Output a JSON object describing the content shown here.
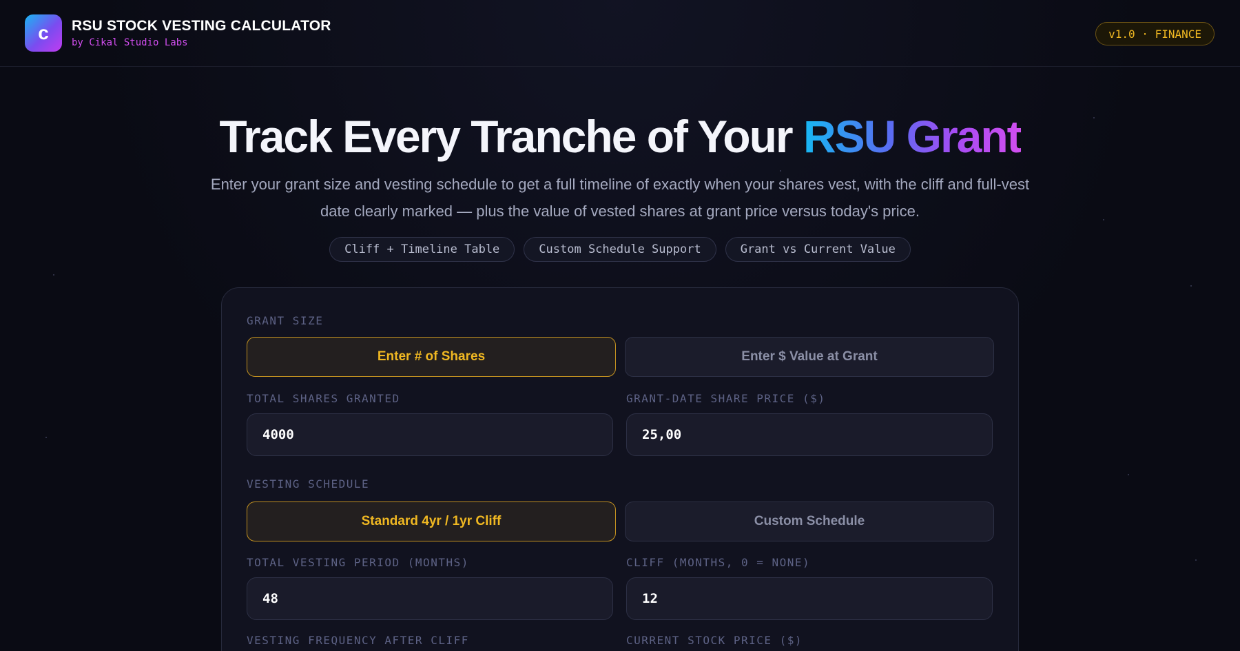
{
  "header": {
    "logo_letter": "c",
    "title": "RSU STOCK VESTING CALCULATOR",
    "subtitle": "by Cikal Studio Labs",
    "version_badge": "v1.0 · FINANCE"
  },
  "hero": {
    "title_plain": "Track Every Tranche of Your ",
    "title_highlight": "RSU Grant",
    "description": "Enter your grant size and vesting schedule to get a full timeline of exactly when your shares vest, with the cliff and full-vest date clearly marked — plus the value of vested shares at grant price versus today's price.",
    "pills": [
      "Cliff + Timeline Table",
      "Custom Schedule Support",
      "Grant vs Current Value"
    ]
  },
  "form": {
    "grant_size_label": "GRANT SIZE",
    "grant_mode_options": [
      "Enter # of Shares",
      "Enter $ Value at Grant"
    ],
    "grant_mode_selected": "Enter # of Shares",
    "total_shares_label": "TOTAL SHARES GRANTED",
    "total_shares_value": "4000",
    "grant_price_label": "GRANT-DATE SHARE PRICE ($)",
    "grant_price_value": "25,00",
    "vesting_schedule_label": "VESTING SCHEDULE",
    "schedule_options": [
      "Standard 4yr / 1yr Cliff",
      "Custom Schedule"
    ],
    "schedule_selected": "Standard 4yr / 1yr Cliff",
    "vesting_period_label": "TOTAL VESTING PERIOD (MONTHS)",
    "vesting_period_value": "48",
    "cliff_label": "CLIFF (MONTHS, 0 = NONE)",
    "cliff_value": "12",
    "frequency_label": "VESTING FREQUENCY AFTER CLIFF",
    "current_price_label": "CURRENT STOCK PRICE ($)"
  },
  "colors": {
    "accent": "#f0b822",
    "brand_gradient_start": "#17b8f3",
    "brand_gradient_end": "#d24ef0",
    "background": "#0a0b14"
  }
}
